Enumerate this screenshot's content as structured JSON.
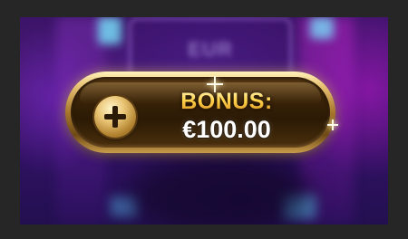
{
  "background": {
    "sign_text": "EUR"
  },
  "bonus": {
    "label": "BONUS:",
    "value": "€100.00",
    "add_icon": "plus-icon"
  },
  "colors": {
    "frame": "#262626",
    "gold_light": "#fff1b8",
    "gold_dark": "#6e4a17",
    "label_gold": "#ffd95a",
    "value_white": "#ffffff",
    "background_purple": "#3b1468",
    "accent_cyan": "#78e6ff"
  }
}
